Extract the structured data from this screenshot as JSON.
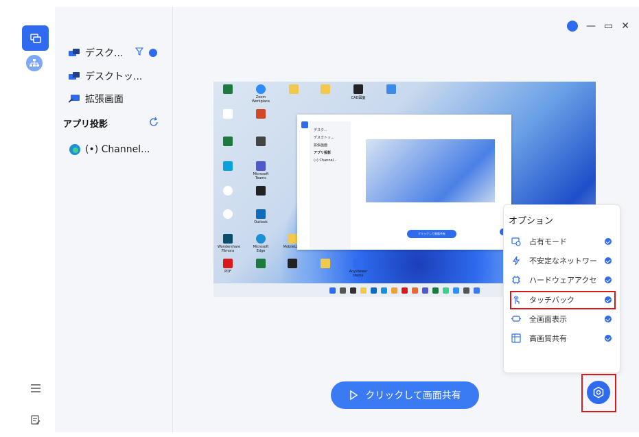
{
  "sidebar": {
    "devices": [
      {
        "label": "デスク..."
      },
      {
        "label": "デスクトッ..."
      },
      {
        "label": "拡張画面"
      }
    ],
    "apps_section_title": "アプリ投影",
    "apps": [
      {
        "label": "(•) Channel..."
      }
    ]
  },
  "preview": {
    "desktop_labels": [
      "Zoom Workplace",
      "CAD図面",
      "Microsoft Teams",
      "Outlook",
      "Microsoft Edge",
      "PDF",
      "Wondershare Filmora",
      "MobileLink",
      "AnyViewer Home"
    ],
    "nested_window": {
      "items": [
        "デスク...",
        "デスクトッ...",
        "拡張画面",
        "アプリ投影",
        "(•) Channel..."
      ],
      "share_label": "クリックして画面共有"
    }
  },
  "options": {
    "title": "オプション",
    "items": [
      {
        "label": "占有モード",
        "icon": "occupy-icon"
      },
      {
        "label": "不安定なネットワー",
        "icon": "bolt-icon"
      },
      {
        "label": "ハードウェアアクセ",
        "icon": "chip-icon"
      },
      {
        "label": "タッチバック",
        "icon": "touch-icon"
      },
      {
        "label": "全画面表示",
        "icon": "fullscreen-icon"
      },
      {
        "label": "高画質共有",
        "icon": "hd-icon"
      }
    ]
  },
  "share_button": {
    "label": "クリックして画面共有"
  },
  "colors": {
    "accent": "#2e6bef",
    "highlight": "#d7191c",
    "panel": "#f4f6fa"
  }
}
